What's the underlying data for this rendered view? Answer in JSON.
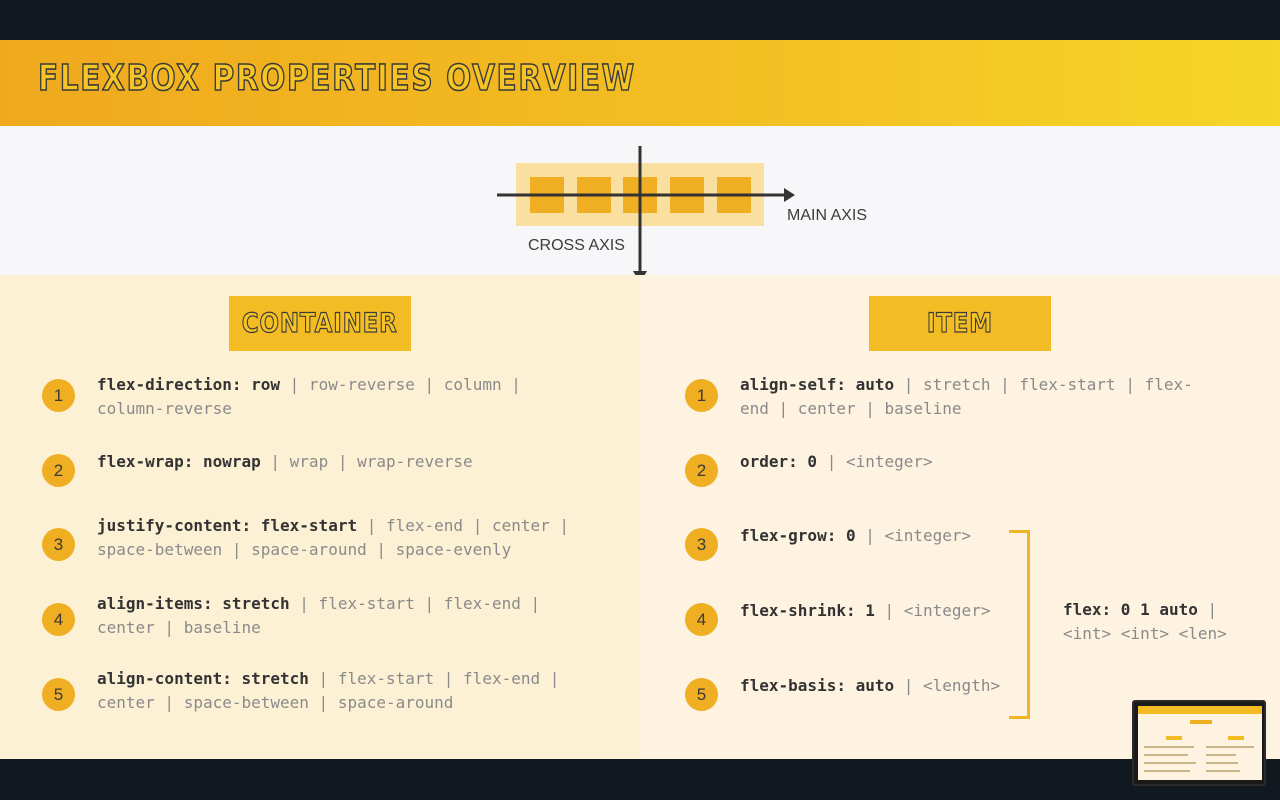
{
  "banner": {
    "title": "FLEXBOX PROPERTIES OVERVIEW"
  },
  "diagram": {
    "main_axis": "MAIN AXIS",
    "cross_axis": "CROSS AXIS",
    "box_count": 5
  },
  "container": {
    "heading": "CONTAINER",
    "items": [
      {
        "num": "1",
        "name": "flex-direction: row",
        "line1_rest": " | row-reverse | column |",
        "line2": "column-reverse"
      },
      {
        "num": "2",
        "name": "flex-wrap: nowrap",
        "line1_rest": " | wrap | wrap-reverse",
        "line2": ""
      },
      {
        "num": "3",
        "name": "justify-content: flex-start",
        "line1_rest": " | flex-end | center |",
        "line2": "space-between | space-around | space-evenly"
      },
      {
        "num": "4",
        "name": "align-items: stretch",
        "line1_rest": " | flex-start | flex-end |",
        "line2": "center | baseline"
      },
      {
        "num": "5",
        "name": "align-content: stretch",
        "line1_rest": " | flex-start | flex-end |",
        "line2": "center | space-between | space-around"
      }
    ]
  },
  "item": {
    "heading": "ITEM",
    "items": [
      {
        "num": "1",
        "name": "align-self: auto",
        "line1_rest": " | stretch | flex-start | flex-",
        "line2": "end | center | baseline"
      },
      {
        "num": "2",
        "name": "order: 0",
        "line1_rest": " | <integer>",
        "line2": ""
      },
      {
        "num": "3",
        "name": "flex-grow: 0",
        "line1_rest": " | <integer>",
        "line2": ""
      },
      {
        "num": "4",
        "name": "flex-shrink: 1",
        "line1_rest": " | <integer>",
        "line2": ""
      },
      {
        "num": "5",
        "name": "flex-basis: auto",
        "line1_rest": " | <length>",
        "line2": ""
      }
    ],
    "shorthand": {
      "name": "flex: 0 1 auto",
      "line1_rest": " |",
      "line2": "<int> <int> <len>"
    }
  },
  "colors": {
    "accent": "#f3bb24",
    "dark": "#121820",
    "text": "#333333"
  }
}
